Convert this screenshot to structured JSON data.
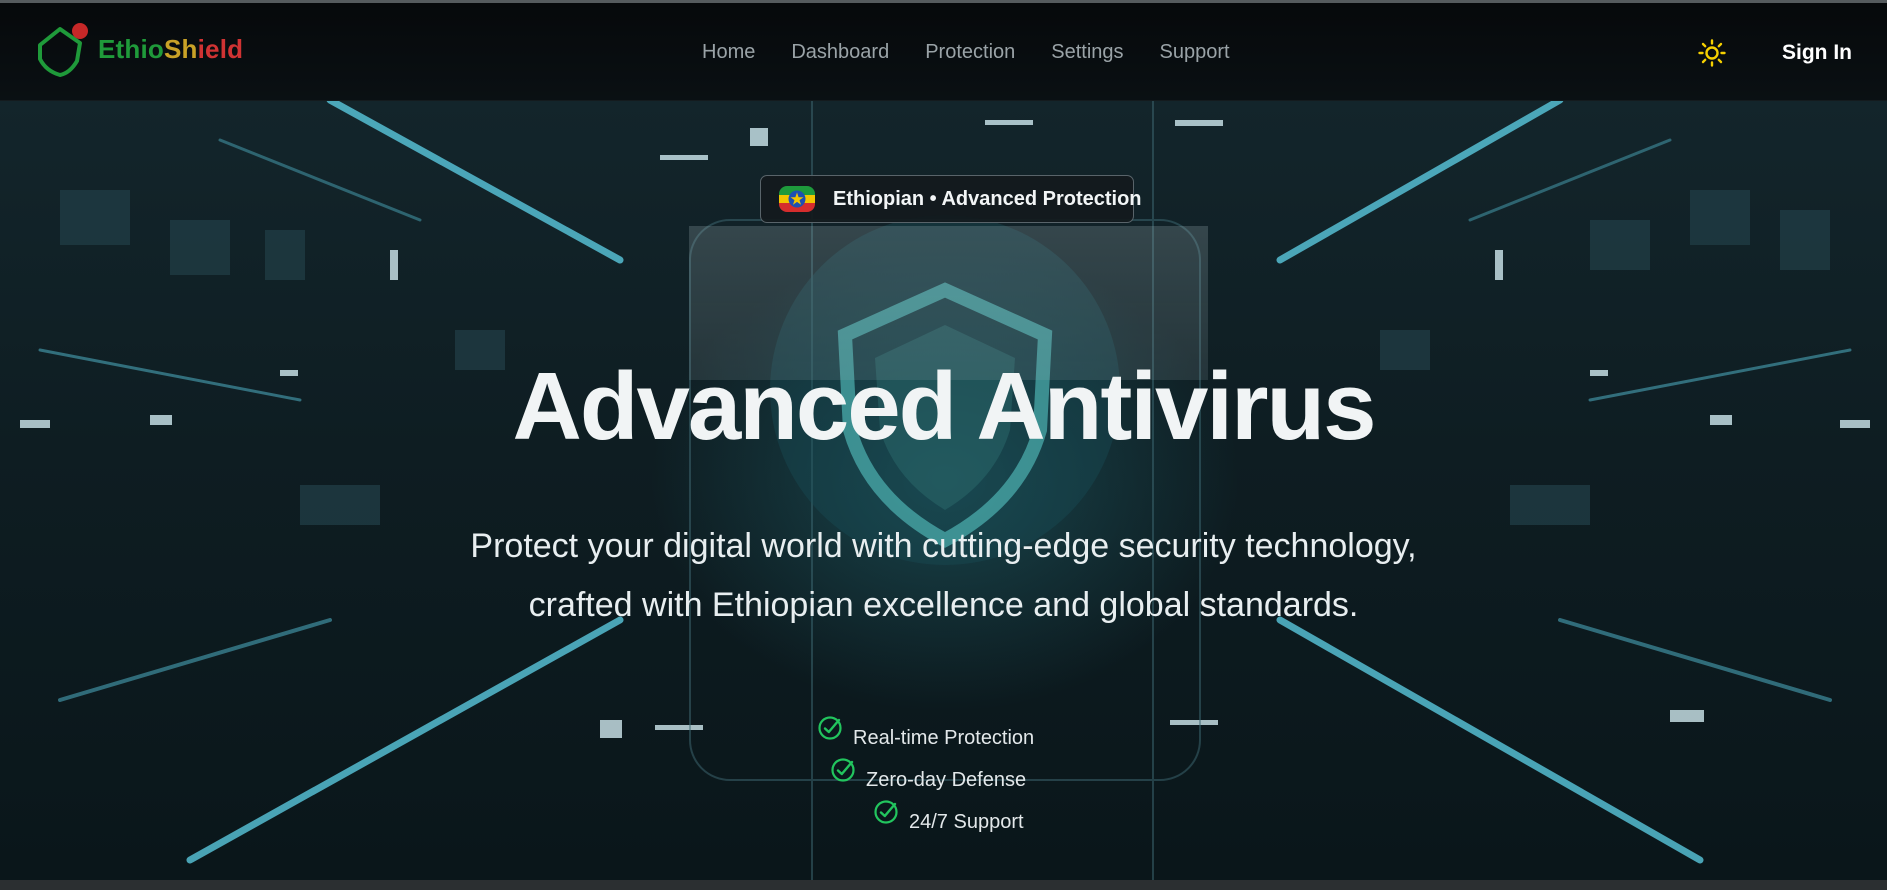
{
  "brand": {
    "name_part1": "Ethio",
    "name_part2": "Sh",
    "name_part3": "ield",
    "colors": {
      "green": "#1f9a3a",
      "yellow": "#c9a227",
      "red": "#d03333"
    }
  },
  "nav": {
    "links": [
      "Home",
      "Dashboard",
      "Protection",
      "Settings",
      "Support"
    ],
    "theme_icon": "sun-icon",
    "sign_in_label": "Sign In"
  },
  "hero": {
    "badge_text": "Ethiopian • Advanced Protection",
    "badge_icon": "ethiopian-flag-icon",
    "title": "Advanced Antivirus",
    "subtitle_line1": "Protect your digital world with cutting-edge security technology,",
    "subtitle_line2": "crafted with Ethiopian excellence and global standards.",
    "features": [
      "Real-time Protection",
      "Zero-day Defense",
      "24/7 Support"
    ],
    "feature_icon": "check-circle-icon",
    "accent_color": "#22c55e"
  }
}
